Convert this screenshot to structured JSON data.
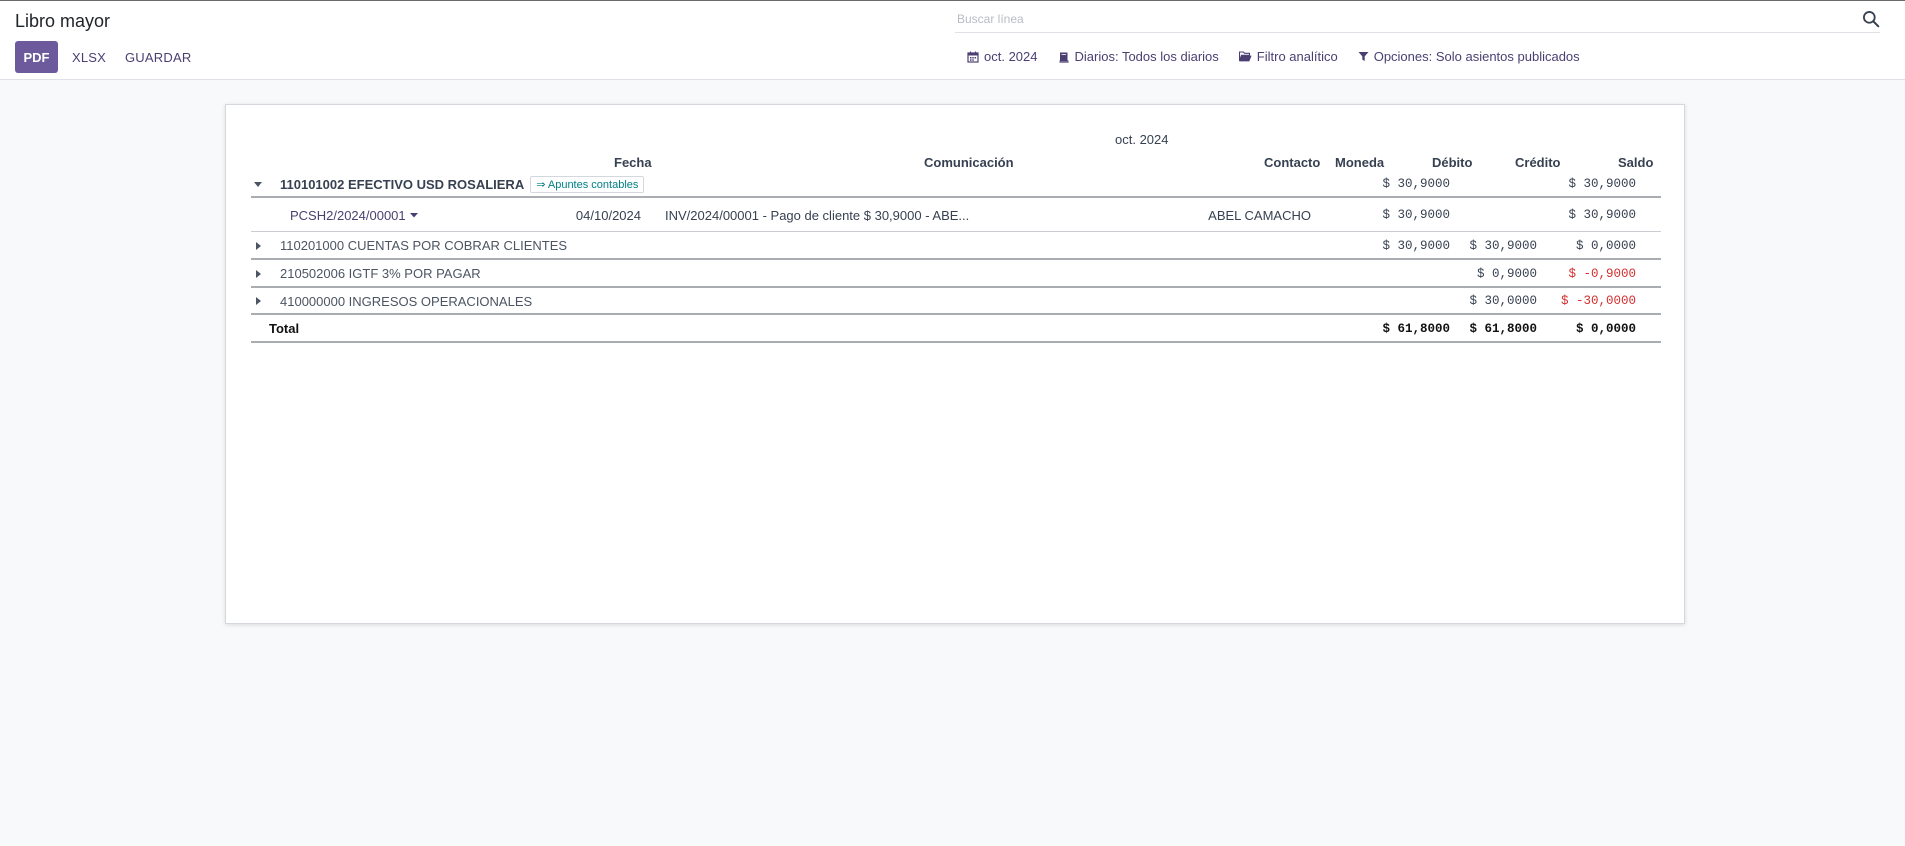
{
  "header": {
    "title": "Libro mayor",
    "buttons": {
      "pdf": "PDF",
      "xlsx": "XLSX",
      "save": "GUARDAR"
    },
    "search": {
      "placeholder": "Buscar línea"
    },
    "filters": {
      "date": "oct. 2024",
      "journals": "Diarios: Todos los diarios",
      "analytic": "Filtro analítico",
      "options": "Opciones: Solo asientos publicados"
    }
  },
  "report": {
    "period": "oct. 2024",
    "columns": {
      "date": "Fecha",
      "communication": "Comunicación",
      "partner": "Contacto",
      "currency": "Moneda",
      "debit": "Débito",
      "credit": "Crédito",
      "balance": "Saldo"
    },
    "main_account": {
      "name": "110101002 EFECTIVO USD ROSALIERA",
      "badge": "⇒ Apuntes contables",
      "debit": "$ 30,9000",
      "credit": "",
      "balance": "$ 30,9000"
    },
    "move_line": {
      "reference": "PCSH2/2024/00001",
      "date": "04/10/2024",
      "communication": "INV/2024/00001 - Pago de cliente $ 30,9000 - ABE...",
      "partner": "ABEL CAMACHO",
      "debit": "$ 30,9000",
      "credit": "",
      "balance": "$ 30,9000"
    },
    "accounts": [
      {
        "name": "110201000 CUENTAS POR COBRAR CLIENTES",
        "debit": "$ 30,9000",
        "credit": "$ 30,9000",
        "balance": "$ 0,0000"
      },
      {
        "name": "210502006 IGTF 3% POR PAGAR",
        "debit": "",
        "credit": "$ 0,9000",
        "balance": "$ -0,9000"
      },
      {
        "name": "410000000 INGRESOS OPERACIONALES",
        "debit": "",
        "credit": "$ 30,0000",
        "balance": "$ -30,0000"
      }
    ],
    "total": {
      "label": "Total",
      "debit": "$ 61,8000",
      "credit": "$ 61,8000",
      "balance": "$ 0,0000"
    }
  },
  "colors": {
    "primary": "#6c5a9c",
    "link": "#4b3f72",
    "negative": "#d32f2f",
    "badge": "#017e84"
  }
}
